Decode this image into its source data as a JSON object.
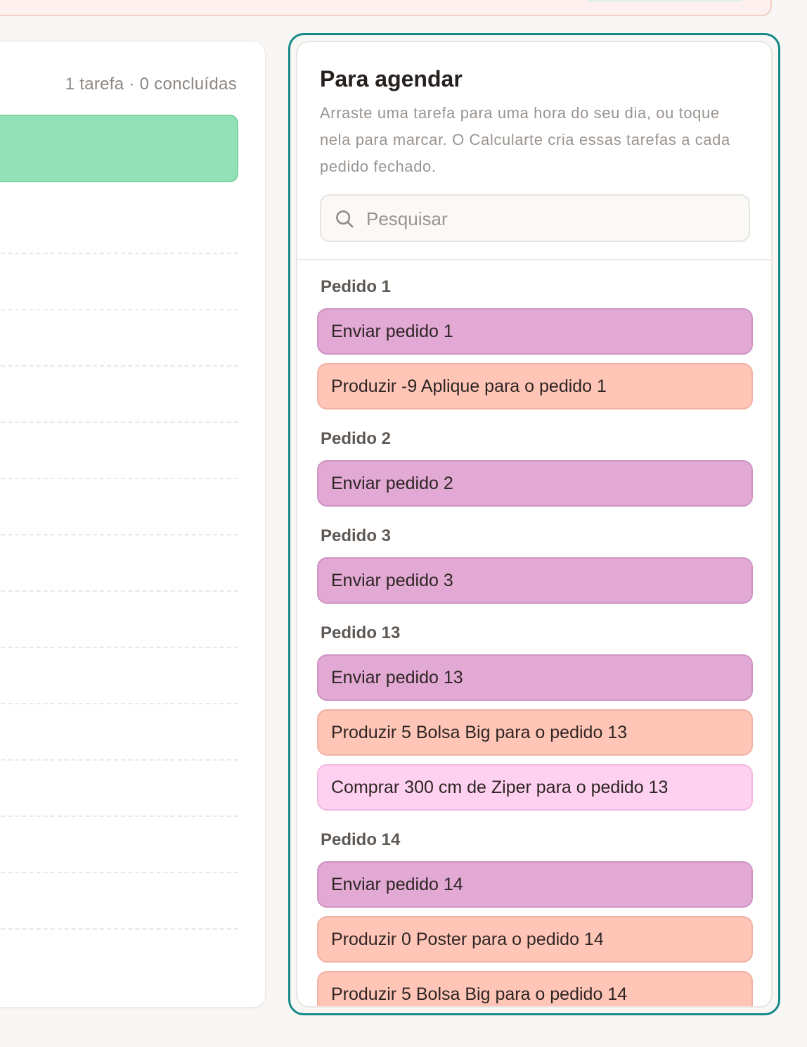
{
  "day": {
    "summary": "1 tarefa · 0 concluídas"
  },
  "schedule": {
    "title": "Para agendar",
    "description": "Arraste uma tarefa para uma hora do seu dia, ou toque nela para marcar. O Calcularte cria essas tarefas a cada pedido fechado.",
    "search": {
      "placeholder": "Pesquisar",
      "icon": "search-icon"
    },
    "groups": [
      {
        "title": "Pedido 1",
        "tasks": [
          {
            "label": "Enviar pedido 1",
            "kind": "enviar"
          },
          {
            "label": "Produzir -9 Aplique para o pedido 1",
            "kind": "produzir"
          }
        ]
      },
      {
        "title": "Pedido 2",
        "tasks": [
          {
            "label": "Enviar pedido 2",
            "kind": "enviar"
          }
        ]
      },
      {
        "title": "Pedido 3",
        "tasks": [
          {
            "label": "Enviar pedido 3",
            "kind": "enviar"
          }
        ]
      },
      {
        "title": "Pedido 13",
        "tasks": [
          {
            "label": "Enviar pedido 13",
            "kind": "enviar"
          },
          {
            "label": "Produzir 5 Bolsa Big para o pedido 13",
            "kind": "produzir"
          },
          {
            "label": "Comprar 300 cm de Ziper para o pedido 13",
            "kind": "comprar"
          }
        ]
      },
      {
        "title": "Pedido 14",
        "tasks": [
          {
            "label": "Enviar pedido 14",
            "kind": "enviar"
          },
          {
            "label": "Produzir 0 Poster para o pedido 14",
            "kind": "produzir"
          },
          {
            "label": "Produzir 5 Bolsa Big para o pedido 14",
            "kind": "produzir"
          }
        ]
      }
    ]
  },
  "colors": {
    "accent": "#16898a",
    "enviar": "#e2a9d5",
    "produzir": "#ffc6b8",
    "comprar": "#fed1f0",
    "scheduled_task": "#93e1b6"
  }
}
